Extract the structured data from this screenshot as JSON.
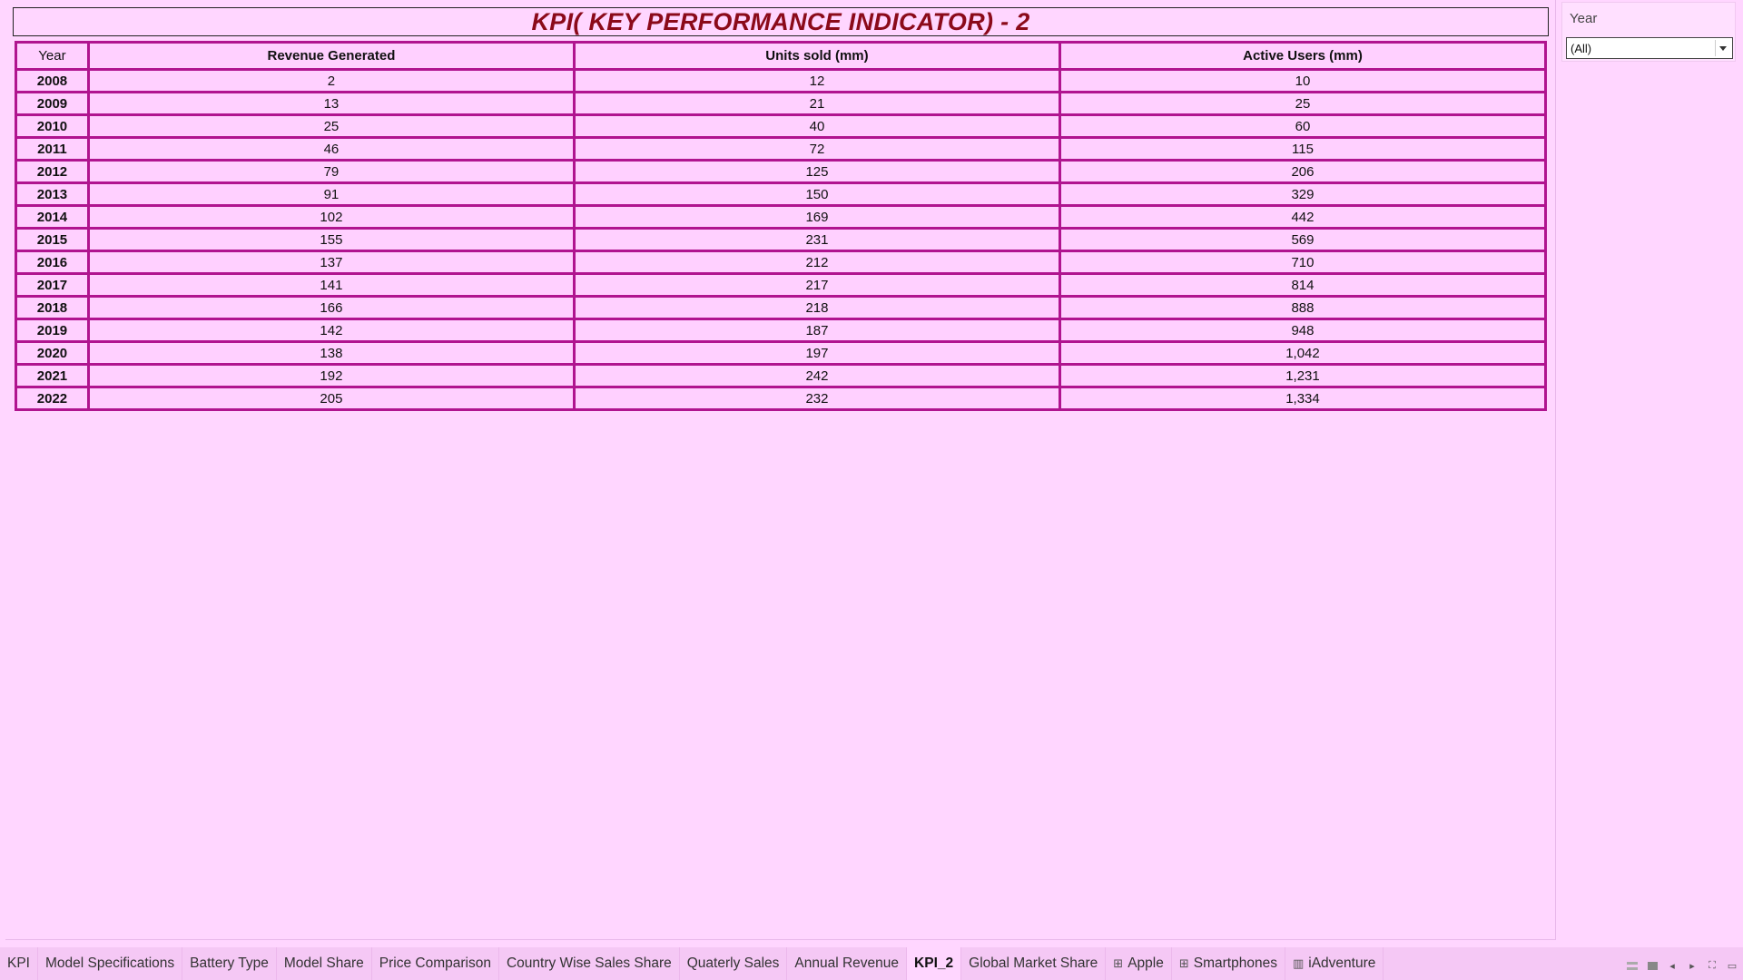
{
  "title": "KPI( KEY PERFORMANCE INDICATOR) - 2",
  "table": {
    "headers": {
      "year": "Year",
      "revenue": "Revenue Generated",
      "units": "Units sold (mm)",
      "users": "Active Users (mm)"
    },
    "rows": [
      {
        "year": "2008",
        "revenue": "2",
        "units": "12",
        "users": "10"
      },
      {
        "year": "2009",
        "revenue": "13",
        "units": "21",
        "users": "25"
      },
      {
        "year": "2010",
        "revenue": "25",
        "units": "40",
        "users": "60"
      },
      {
        "year": "2011",
        "revenue": "46",
        "units": "72",
        "users": "115"
      },
      {
        "year": "2012",
        "revenue": "79",
        "units": "125",
        "users": "206"
      },
      {
        "year": "2013",
        "revenue": "91",
        "units": "150",
        "users": "329"
      },
      {
        "year": "2014",
        "revenue": "102",
        "units": "169",
        "users": "442"
      },
      {
        "year": "2015",
        "revenue": "155",
        "units": "231",
        "users": "569"
      },
      {
        "year": "2016",
        "revenue": "137",
        "units": "212",
        "users": "710"
      },
      {
        "year": "2017",
        "revenue": "141",
        "units": "217",
        "users": "814"
      },
      {
        "year": "2018",
        "revenue": "166",
        "units": "218",
        "users": "888"
      },
      {
        "year": "2019",
        "revenue": "142",
        "units": "187",
        "users": "948"
      },
      {
        "year": "2020",
        "revenue": "138",
        "units": "197",
        "users": "1,042"
      },
      {
        "year": "2021",
        "revenue": "192",
        "units": "242",
        "users": "1,231"
      },
      {
        "year": "2022",
        "revenue": "205",
        "units": "232",
        "users": "1,334"
      }
    ]
  },
  "filter": {
    "title": "Year",
    "selected": "(All)"
  },
  "tabs": [
    {
      "label": "KPI",
      "icon": ""
    },
    {
      "label": "Model Specifications",
      "icon": ""
    },
    {
      "label": "Battery Type",
      "icon": ""
    },
    {
      "label": "Model Share",
      "icon": ""
    },
    {
      "label": "Price Comparison",
      "icon": ""
    },
    {
      "label": "Country Wise Sales Share",
      "icon": ""
    },
    {
      "label": "Quaterly Sales",
      "icon": ""
    },
    {
      "label": "Annual Revenue",
      "icon": ""
    },
    {
      "label": "KPI_2",
      "icon": "",
      "active": true
    },
    {
      "label": "Global Market Share",
      "icon": ""
    },
    {
      "label": "Apple",
      "icon": "dashboard-icon"
    },
    {
      "label": "Smartphones",
      "icon": "dashboard-icon"
    },
    {
      "label": "iAdventure",
      "icon": "story-icon"
    }
  ],
  "colors": {
    "background": "#ffd6ff",
    "title": "#8b0a1a",
    "table_border": "#b0148f",
    "tab_bar": "#f5c8f5"
  }
}
